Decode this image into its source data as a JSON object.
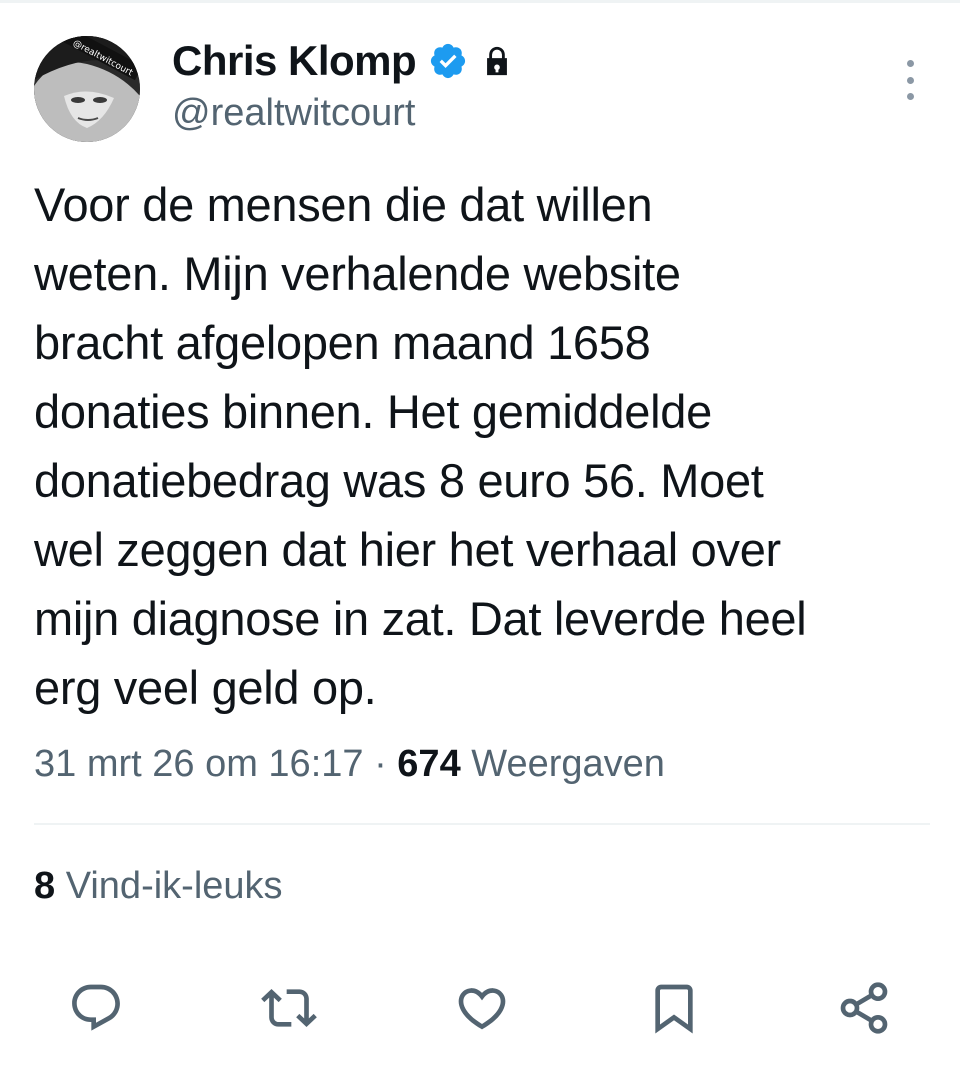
{
  "user": {
    "display_name": "Chris Klomp",
    "handle": "@realtwitcourt",
    "avatar_overlay_text": "@realtwitcourt"
  },
  "tweet": {
    "text": "Voor de mensen die dat willen\nweten. Mijn verhalende website\nbracht afgelopen maand 1658\ndonaties binnen. Het gemiddelde\ndonatiebedrag was 8 euro 56. Moet\nwel zeggen dat hier het verhaal over\nmijn diagnose in zat. Dat leverde heel\nerg veel geld op.",
    "timestamp": "31 mrt 26 om 16:17",
    "separator": " · ",
    "views_count": "674",
    "views_label": " Weergaven",
    "likes_count": "8",
    "likes_label": " Vind-ik-leuks"
  },
  "actions": [
    {
      "name": "reply",
      "icon": "reply-icon"
    },
    {
      "name": "retweet",
      "icon": "retweet-icon"
    },
    {
      "name": "like",
      "icon": "heart-icon"
    },
    {
      "name": "bookmark",
      "icon": "bookmark-icon"
    },
    {
      "name": "share",
      "icon": "share-icon"
    }
  ],
  "colors": {
    "text_primary": "#0f1419",
    "text_secondary": "#536471",
    "verified_blue": "#1d9bf0",
    "icon_gray": "#536471",
    "divider": "#eff3f4"
  }
}
